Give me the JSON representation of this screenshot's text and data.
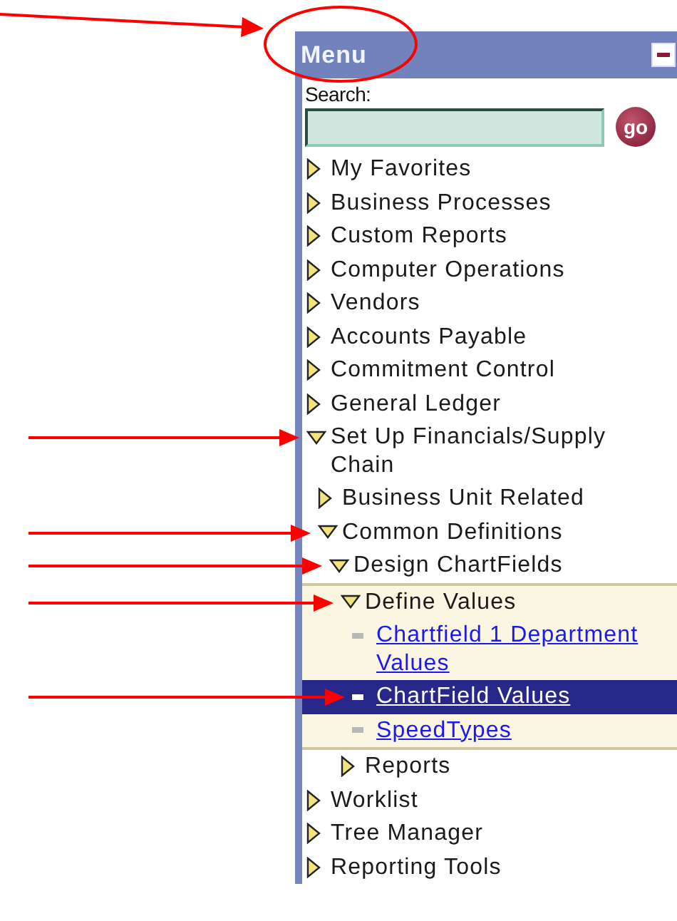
{
  "menu": {
    "title": "Menu",
    "title_circled": true,
    "title_arrow": true,
    "search_label": "Search:",
    "go_button": "go",
    "items": [
      {
        "label": "My Favorites",
        "expanded": false
      },
      {
        "label": "Business Processes",
        "expanded": false
      },
      {
        "label": "Custom Reports",
        "expanded": false
      },
      {
        "label": "Computer Operations",
        "expanded": false
      },
      {
        "label": "Vendors",
        "expanded": false
      },
      {
        "label": "Accounts Payable",
        "expanded": false
      },
      {
        "label": "Commitment Control",
        "expanded": false
      },
      {
        "label": "General Ledger",
        "expanded": false
      },
      {
        "label": "Set Up Financials/Supply Chain",
        "expanded": true,
        "arrow": true,
        "children": [
          {
            "label": "Business Unit Related",
            "expanded": false
          },
          {
            "label": "Common Definitions",
            "expanded": true,
            "arrow": true,
            "children": [
              {
                "label": "Design ChartFields",
                "expanded": true,
                "arrow": true,
                "children": [
                  {
                    "label": "Define Values",
                    "expanded": true,
                    "arrow": true,
                    "current": true,
                    "children": [
                      {
                        "kind": "link",
                        "label": "Chartfield 1 Department Values",
                        "selected": false
                      },
                      {
                        "kind": "link",
                        "label": "ChartField Values",
                        "selected": true,
                        "arrow": true
                      },
                      {
                        "kind": "link",
                        "label": "SpeedTypes",
                        "selected": false
                      }
                    ]
                  },
                  {
                    "label": "Reports",
                    "expanded": false
                  }
                ]
              }
            ]
          }
        ]
      },
      {
        "label": "Worklist",
        "expanded": false
      },
      {
        "label": "Tree Manager",
        "expanded": false
      },
      {
        "label": "Reporting Tools",
        "expanded": false
      }
    ]
  }
}
